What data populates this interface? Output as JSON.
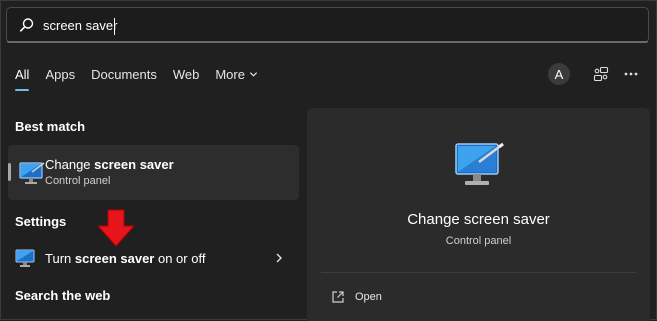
{
  "search": {
    "value": "screen saver"
  },
  "tabs": [
    {
      "label": "All",
      "active": true
    },
    {
      "label": "Apps"
    },
    {
      "label": "Documents"
    },
    {
      "label": "Web"
    },
    {
      "label": "More"
    }
  ],
  "header": {
    "avatar_initial": "A"
  },
  "best_match": {
    "heading": "Best match",
    "title_prefix": "Change ",
    "title_bold": "screen saver",
    "subtitle": "Control panel"
  },
  "settings": {
    "heading": "Settings",
    "item": {
      "prefix": "Turn ",
      "bold": "screen saver",
      "suffix": " on or off"
    }
  },
  "web": {
    "heading": "Search the web"
  },
  "preview": {
    "title": "Change screen saver",
    "subtitle": "Control panel",
    "actions": [
      {
        "label": "Open",
        "icon": "open-external-icon"
      }
    ]
  },
  "colors": {
    "accent": "#76b9ed",
    "annotation_arrow": "#e8141c"
  }
}
